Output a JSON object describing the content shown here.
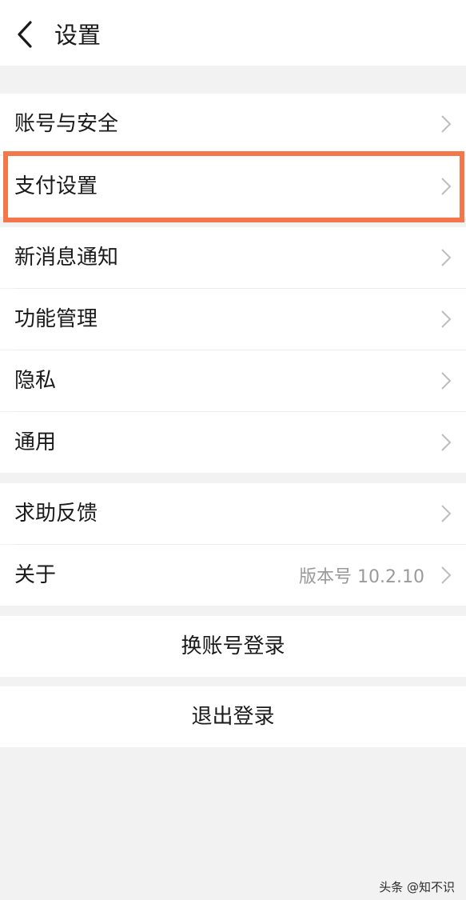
{
  "header": {
    "title": "设置"
  },
  "menu": {
    "account_security": "账号与安全",
    "payment_settings": "支付设置",
    "new_message_notifications": "新消息通知",
    "feature_management": "功能管理",
    "privacy": "隐私",
    "general": "通用",
    "help_feedback": "求助反馈",
    "about": "关于",
    "about_version": "版本号 10.2.10"
  },
  "actions": {
    "switch_account": "换账号登录",
    "logout": "退出登录"
  },
  "colors": {
    "highlight_border": "#f4764b",
    "page_background": "#f2f2f2",
    "row_background": "#ffffff"
  },
  "watermark": "头条 @知不识"
}
